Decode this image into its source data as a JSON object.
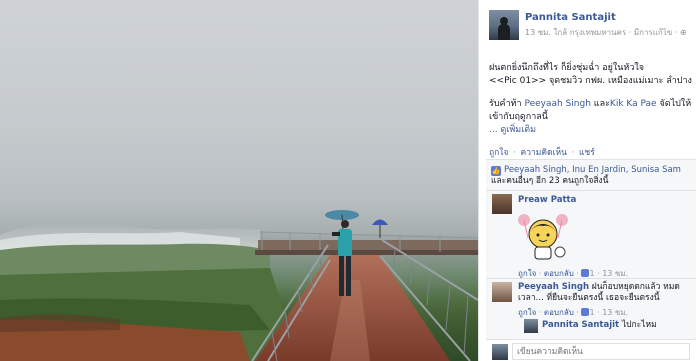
{
  "post": {
    "author": "Pannita Santajit",
    "meta": "13 ชม. ใกล้ กรุงเทพมหานคร · มีการแก้ไข · ",
    "audience_icon": "globe-icon",
    "text_line1": "ฝนตกยิ่งนึกถึงที่ไร ก็ยิ่งชุ่มฉ่ำ อยู่ในหัวใจ",
    "text_line2": "<<Pic 01>> จุดชมวิว กฟผ. เหมืองแม่เมาะ ลำปาง",
    "text_thanks_prefix": "รับคำท้า ",
    "mention1": "Peeyaah Singh",
    "text_and": " และ",
    "mention2": "Kik Ka Pae",
    "text_thanks_suffix": " จัดไปให้",
    "text_line4": "เข้ากับฤดูกาลนี้",
    "see_more": "... ดูเพิ่มเติม"
  },
  "actions": {
    "like": "ถูกใจ",
    "comment": "ความคิดเห็น",
    "share": "แชร์",
    "separator": "·"
  },
  "likes_summary": {
    "icon": "like-thumb-icon",
    "names": "Peeyaah Singh, Inu En Jardin, Sunisa Sam",
    "rest": "และคนอื่นๆ อีก 23 คนถูกใจสิ่งนี้"
  },
  "comments": [
    {
      "author": "Preaw Patta",
      "text": "",
      "sticker": "cartoon-girl-sticker",
      "like": "ถูกใจ",
      "reply": "ตอบกลับ",
      "likes": "1",
      "time": "13 ชม."
    },
    {
      "author": "Peeyaah Singh",
      "text": "ฝนก็อบหยุดตกแล้ว หมดเวลา... ที่ยืนจะยืนตรงนี้ เธอจะยืนตรงนี้",
      "like": "ถูกใจ",
      "reply": "ตอบกลับ",
      "likes": "1",
      "time": "13 ชม."
    },
    {
      "author": "Pannita Santajit",
      "text": "ไปกะไหม",
      "like": "",
      "reply": "",
      "likes": "",
      "time": ""
    }
  ],
  "composer": {
    "placeholder": "เขียนความคิดเห็น"
  },
  "colors": {
    "link": "#3b5998",
    "text": "#141823",
    "muted": "#90949c",
    "comments_bg": "#f6f7f9"
  }
}
